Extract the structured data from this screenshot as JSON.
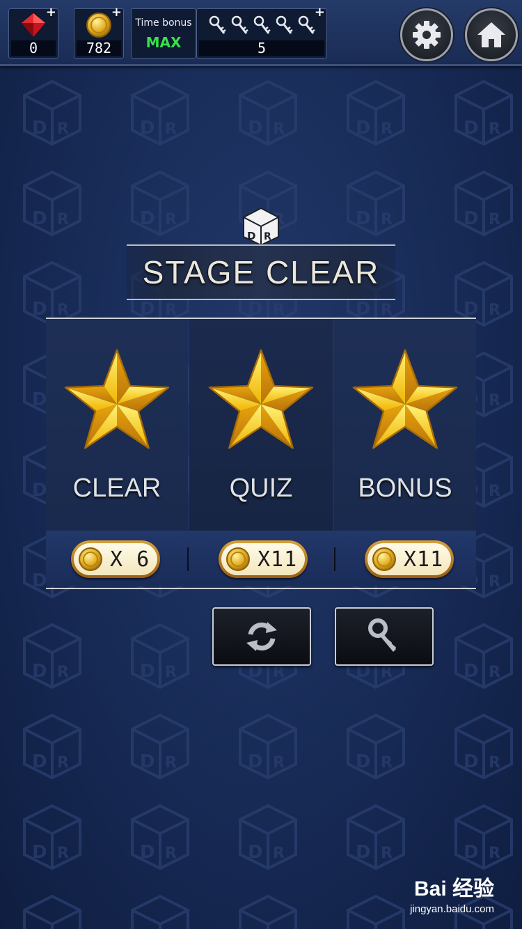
{
  "hud": {
    "gems": "0",
    "coins": "782",
    "time_bonus_label": "Time bonus",
    "time_bonus_value": "MAX",
    "keys": "5",
    "plus_symbol": "+",
    "key_icon_count": 5,
    "settings_icon": "gear-icon",
    "home_icon": "home-icon"
  },
  "banner": {
    "logo_text": "DR",
    "title": "STAGE CLEAR"
  },
  "results": [
    {
      "label": "CLEAR",
      "earned": true,
      "reward": "X 6"
    },
    {
      "label": "QUIZ",
      "earned": true,
      "reward": "X11"
    },
    {
      "label": "BONUS",
      "earned": true,
      "reward": "X11"
    }
  ],
  "actions": {
    "retry_icon": "refresh-icon",
    "hint_icon": "key-icon"
  },
  "watermark": {
    "logo": "Bai 经验",
    "url": "jingyan.baidu.com"
  },
  "colors": {
    "background": "#172a55",
    "star_gold": "#f2c21c",
    "time_bonus_green": "#38e04a",
    "pill_gold": "#c98a2a"
  }
}
